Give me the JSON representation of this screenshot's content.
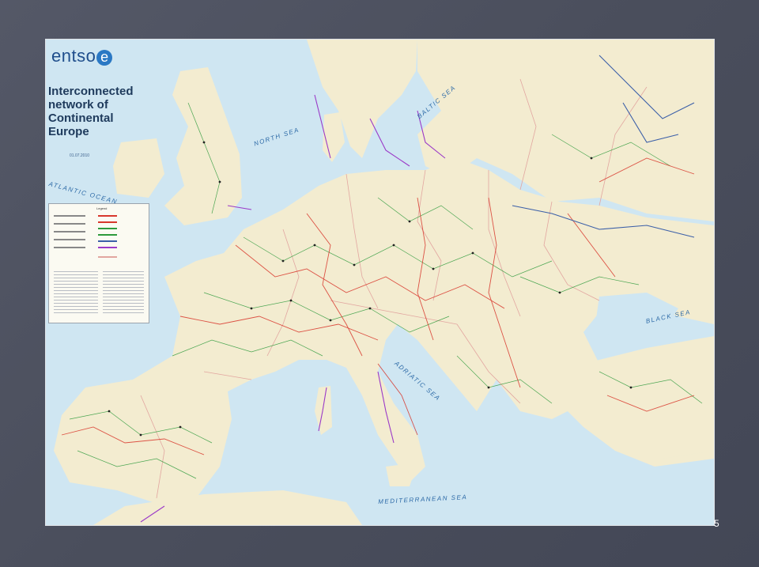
{
  "map": {
    "logo_text": "entso",
    "logo_mark": "e",
    "title_lines": [
      "Interconnected",
      "network of",
      "Continental",
      "Europe"
    ],
    "date": "01.07.2010",
    "legend_title": "Legend",
    "sea_labels": {
      "north_sea": "NORTH SEA",
      "baltic_sea": "BALTIC SEA",
      "atlantic_ocean": "ATLANTIC OCEAN",
      "black_sea": "BLACK SEA",
      "adriatic_sea": "ADRIATIC SEA",
      "mediterranean_sea": "MEDITERRANEAN SEA"
    },
    "colors": {
      "sea": "#cfe6f2",
      "land": "#f3ecd0",
      "line_220kv": "#2e9a3c",
      "line_400kv": "#d8372c",
      "line_dc": "#9b3ac8",
      "line_750kv": "#3b5fa8"
    }
  },
  "slide": {
    "page_number": "5"
  }
}
